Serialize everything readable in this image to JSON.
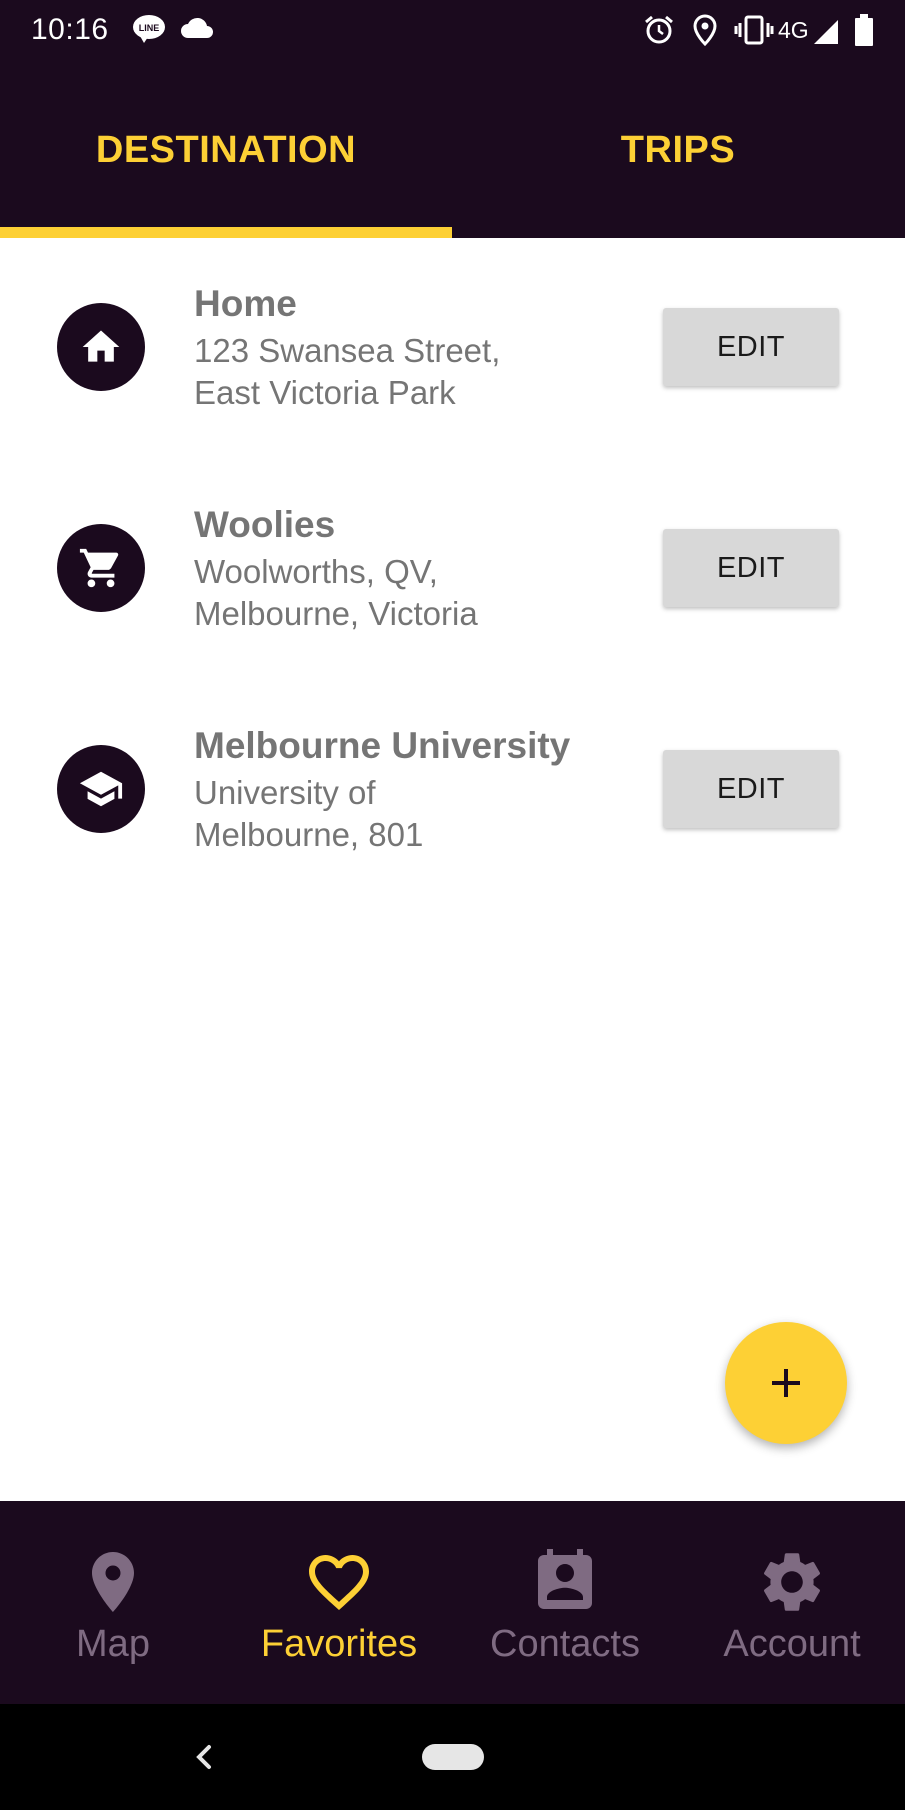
{
  "status_bar": {
    "time": "10:16",
    "network": "4G",
    "icons": [
      "line-icon",
      "cloud-icon",
      "alarm-icon",
      "location-icon",
      "vibrate-icon",
      "signal-icon",
      "battery-icon"
    ]
  },
  "tabs": [
    {
      "label": "DESTINATION",
      "active": true
    },
    {
      "label": "TRIPS",
      "active": false
    }
  ],
  "destinations": [
    {
      "name": "Home",
      "address_line1": "123 Swansea Street,",
      "address_line2": "East Victoria Park",
      "icon": "home-icon",
      "edit_label": "EDIT"
    },
    {
      "name": "Woolies",
      "address_line1": "Woolworths, QV,",
      "address_line2": "Melbourne, Victoria",
      "icon": "cart-icon",
      "edit_label": "EDIT"
    },
    {
      "name": "Melbourne University",
      "address_line1": "University of",
      "address_line2": "Melbourne, 801",
      "icon": "graduation-cap-icon",
      "edit_label": "EDIT"
    }
  ],
  "fab": {
    "label": "+"
  },
  "bottom_nav": [
    {
      "label": "Map",
      "icon": "map-pin-icon",
      "active": false
    },
    {
      "label": "Favorites",
      "icon": "heart-icon",
      "active": true
    },
    {
      "label": "Contacts",
      "icon": "contact-card-icon",
      "active": false
    },
    {
      "label": "Account",
      "icon": "gear-icon",
      "active": false
    }
  ],
  "colors": {
    "primary_dark": "#1b0a1e",
    "accent": "#fdd035",
    "text_gray": "#757575",
    "button_gray": "#d8d8d8",
    "nav_inactive": "#7f6b82"
  }
}
